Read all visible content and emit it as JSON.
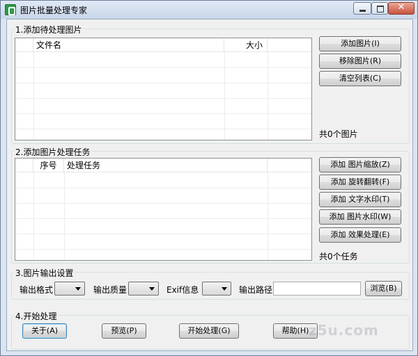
{
  "window": {
    "title": "图片批量处理专家",
    "close_glyph": "✕"
  },
  "section1": {
    "label": "1.添加待处理图片",
    "columns": [
      "文件名",
      "大小"
    ],
    "buttons": {
      "add": "添加图片(I)",
      "remove": "移除图片(R)",
      "clear": "清空列表(C)"
    },
    "count": "共0个图片"
  },
  "section2": {
    "label": "2.添加图片处理任务",
    "columns": [
      "序号",
      "处理任务"
    ],
    "buttons": {
      "resize": "添加 图片缩放(Z)",
      "rotate": "添加 旋转翻转(F)",
      "text_watermark": "添加 文字水印(T)",
      "image_watermark": "添加 图片水印(W)",
      "effect": "添加 效果处理(E)"
    },
    "count": "共0个任务"
  },
  "section3": {
    "label": "3.图片输出设置",
    "format_label": "输出格式",
    "quality_label": "输出质量",
    "exif_label": "Exif信息",
    "path_label": "输出路径",
    "path_value": "",
    "browse": "浏览(B)"
  },
  "section4": {
    "label": "4.开始处理",
    "about": "关于(A)",
    "preview": "预览(P)",
    "start": "开始处理(G)",
    "help": "帮助(H)"
  },
  "watermark": "z5u.com"
}
